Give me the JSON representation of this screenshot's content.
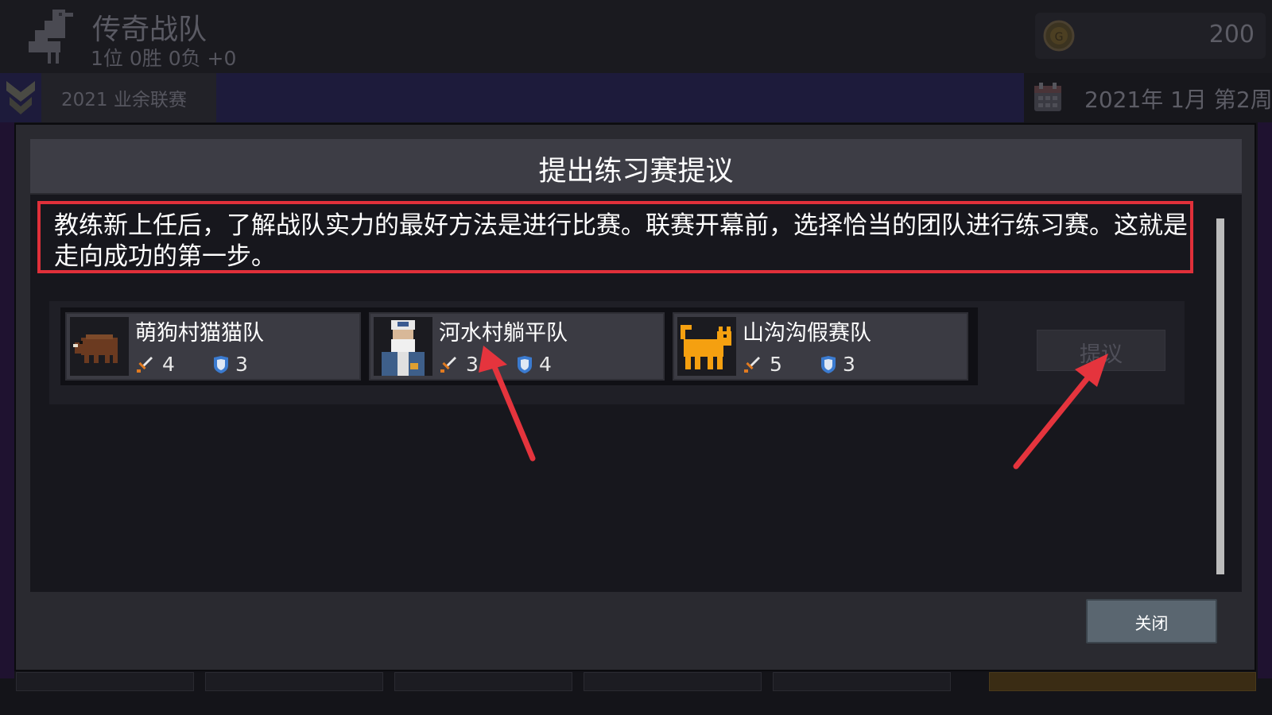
{
  "header": {
    "team_name": "传奇战队",
    "team_record": "1位 0胜 0负 +0",
    "coins": "200"
  },
  "subbar": {
    "league_name": "2021 业余联赛",
    "date": "2021年 1月 第2周"
  },
  "dialog": {
    "title": "提出练习赛提议",
    "intro": "教练新上任后，了解战队实力的最好方法是进行比赛。联赛开幕前，选择恰当的团队进行练习赛。这就是走向成功的第一步。",
    "teams": [
      {
        "name": "萌狗村猫猫队",
        "attack": "4",
        "defense": "3",
        "portrait": "boar-portrait-icon"
      },
      {
        "name": "河水村躺平队",
        "attack": "3",
        "defense": "4",
        "portrait": "old-captain-portrait-icon"
      },
      {
        "name": "山沟沟假赛队",
        "attack": "5",
        "defense": "3",
        "portrait": "cat-portrait-icon"
      }
    ],
    "propose_label": "提议",
    "close_label": "关闭"
  },
  "colors": {
    "highlight": "#e0303a",
    "annotation_arrow": "#e5343d",
    "close_button": "#5a6670"
  }
}
